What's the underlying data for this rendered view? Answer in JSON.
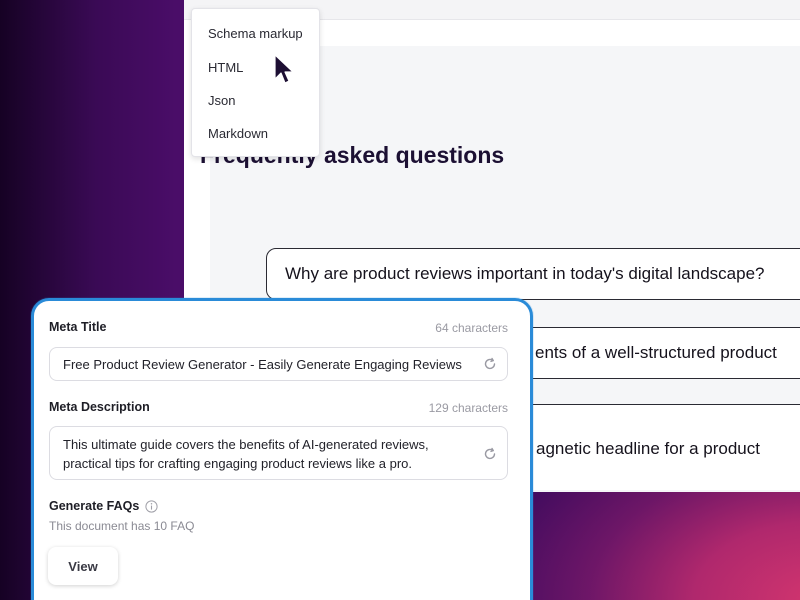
{
  "dropdown": {
    "items": [
      {
        "label": "Schema markup"
      },
      {
        "label": "HTML"
      },
      {
        "label": "Json"
      },
      {
        "label": "Markdown"
      }
    ]
  },
  "faq": {
    "title": "Frequently asked questions",
    "questions": [
      "Why are product reviews important in today's digital landscape?",
      "ents of a well-structured product",
      "agnetic headline for a product"
    ]
  },
  "seo_panel": {
    "meta_title": {
      "label": "Meta Title",
      "count": "64 characters",
      "value": "Free Product Review Generator - Easily Generate Engaging Reviews"
    },
    "meta_description": {
      "label": "Meta Description",
      "count": "129 characters",
      "value_line1": "This ultimate guide covers the benefits of AI-generated reviews,",
      "value_line2": "practical tips for crafting engaging product reviews like a pro."
    },
    "faqs": {
      "label": "Generate FAQs",
      "subtext": "This document has 10 FAQ",
      "view_label": "View"
    }
  },
  "colors": {
    "accent_border": "#2a8bd8",
    "background_dark": "#3a0a55",
    "background_pink": "#d2356e"
  },
  "icons": {
    "refresh": "refresh-icon",
    "info": "info-icon",
    "cursor": "cursor-icon"
  }
}
